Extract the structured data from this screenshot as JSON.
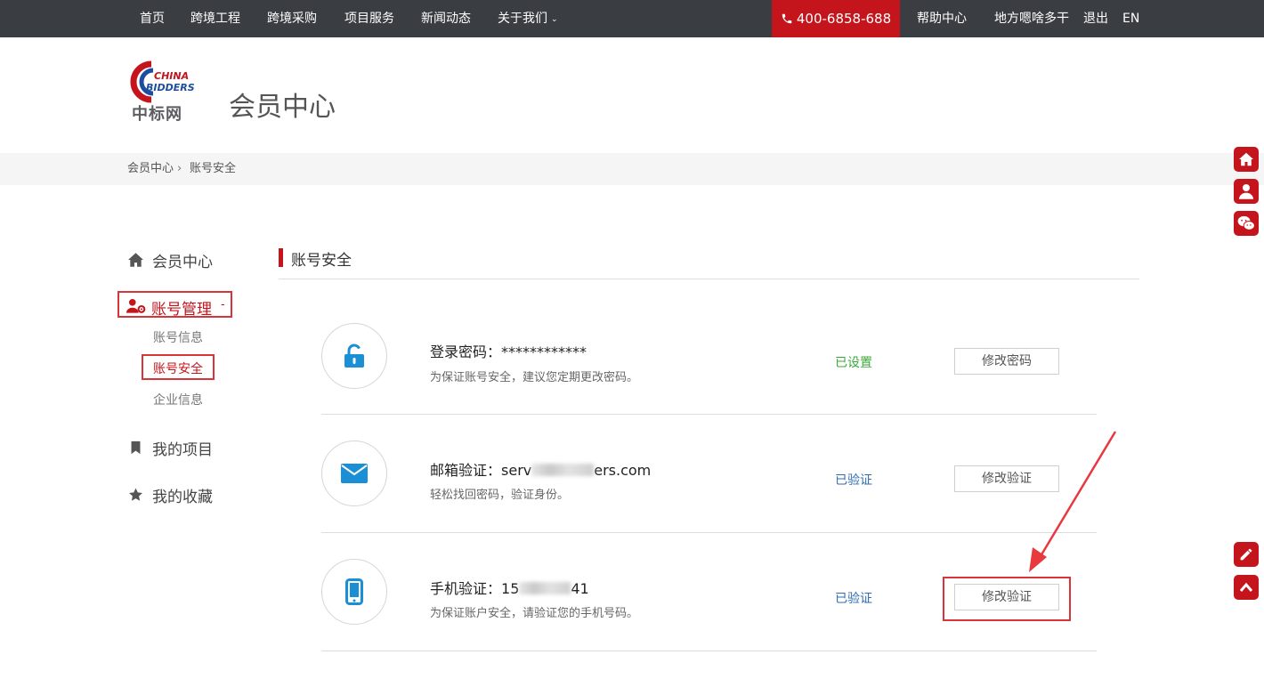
{
  "nav": {
    "items": [
      "首页",
      "跨境工程",
      "跨境采购",
      "项目服务",
      "新闻动态",
      "关于我们"
    ],
    "phone": "400-6858-688",
    "help": "帮助中心",
    "user": "地方嗯啥多干",
    "logout": "退出",
    "lang": "EN"
  },
  "header": {
    "logo_text_en_1": "CHINA",
    "logo_text_en_2": "BIDDERS",
    "logo_text_cn": "中标网",
    "title": "会员中心"
  },
  "breadcrumb": {
    "home": "会员中心",
    "separator": "›",
    "current": "账号安全"
  },
  "sidebar": {
    "member_center": "会员中心",
    "account_manage": "账号管理",
    "account_toggle": "-",
    "sub_items": [
      "账号信息",
      "账号安全",
      "企业信息"
    ],
    "my_projects": "我的项目",
    "my_favorites": "我的收藏"
  },
  "section": {
    "title": "账号安全"
  },
  "rows": [
    {
      "label": "登录密码：",
      "value": "************",
      "desc": "为保证账号安全，建议您定期更改密码。",
      "status": "已设置",
      "button": "修改密码",
      "icon": "unlock-icon"
    },
    {
      "label": "邮箱验证：",
      "value_prefix": "serv",
      "value_suffix": "ers.com",
      "desc": "轻松找回密码，验证身份。",
      "status": "已验证",
      "button": "修改验证",
      "icon": "envelope-icon"
    },
    {
      "label": "手机验证：",
      "value_prefix": "15",
      "value_suffix": "41",
      "desc": "为保证账户安全，请验证您的手机号码。",
      "status": "已验证",
      "button": "修改验证",
      "icon": "mobile-icon"
    }
  ],
  "colors": {
    "brand_red": "#c4151c",
    "nav_bg": "#3a3d41",
    "icon_blue": "#1a8fd6",
    "status_green": "#3aa83a",
    "status_blue": "#2f6db3",
    "annotation_red": "#d9343a"
  }
}
